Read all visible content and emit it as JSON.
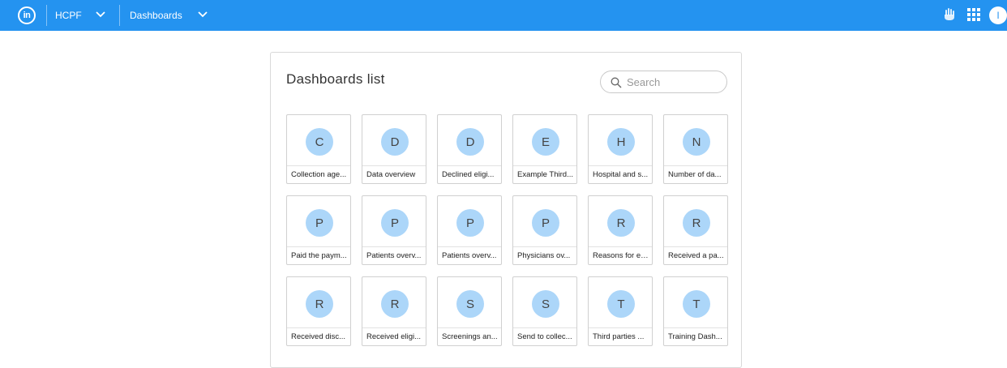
{
  "header": {
    "logo_text": "in",
    "org": "HCPF",
    "section": "Dashboards",
    "user_initial": "I",
    "accent": "#2493f0"
  },
  "panel": {
    "title": "Dashboards list",
    "search_placeholder": "Search"
  },
  "dashboards": [
    {
      "initial": "C",
      "label": "Collection age..."
    },
    {
      "initial": "D",
      "label": "Data overview"
    },
    {
      "initial": "D",
      "label": "Declined eligi..."
    },
    {
      "initial": "E",
      "label": "Example Third..."
    },
    {
      "initial": "H",
      "label": "Hospital and s..."
    },
    {
      "initial": "N",
      "label": "Number of da..."
    },
    {
      "initial": "P",
      "label": "Paid the paym..."
    },
    {
      "initial": "P",
      "label": "Patients overv..."
    },
    {
      "initial": "P",
      "label": "Patients overv..."
    },
    {
      "initial": "P",
      "label": "Physicians ov..."
    },
    {
      "initial": "R",
      "label": "Reasons for el..."
    },
    {
      "initial": "R",
      "label": "Received a pa..."
    },
    {
      "initial": "R",
      "label": "Received disc..."
    },
    {
      "initial": "R",
      "label": "Received eligi..."
    },
    {
      "initial": "S",
      "label": "Screenings an..."
    },
    {
      "initial": "S",
      "label": "Send to collec..."
    },
    {
      "initial": "T",
      "label": "Third parties ..."
    },
    {
      "initial": "T",
      "label": "Training Dash..."
    }
  ]
}
